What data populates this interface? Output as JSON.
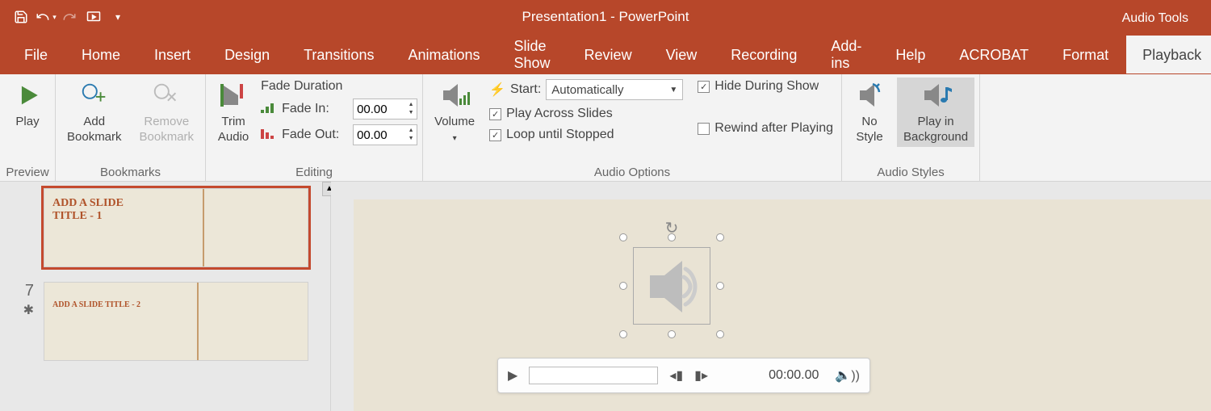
{
  "title": "Presentation1  -  PowerPoint",
  "contextual_title": "Audio Tools",
  "tabs": [
    "File",
    "Home",
    "Insert",
    "Design",
    "Transitions",
    "Animations",
    "Slide Show",
    "Review",
    "View",
    "Recording",
    "Add-ins",
    "Help",
    "ACROBAT"
  ],
  "ctx_tabs": {
    "format": "Format",
    "playback": "Playback"
  },
  "ribbon": {
    "preview": {
      "play": "Play",
      "group": "Preview"
    },
    "bookmarks": {
      "add": "Add\nBookmark",
      "remove": "Remove\nBookmark",
      "group": "Bookmarks"
    },
    "editing": {
      "trim": "Trim\nAudio",
      "fade_header": "Fade Duration",
      "fade_in_label": "Fade In:",
      "fade_out_label": "Fade Out:",
      "fade_in_val": "00.00",
      "fade_out_val": "00.00",
      "group": "Editing"
    },
    "options": {
      "volume": "Volume",
      "start_label": "Start:",
      "start_value": "Automatically",
      "play_across": "Play Across Slides",
      "loop": "Loop until Stopped",
      "hide": "Hide During Show",
      "rewind": "Rewind after Playing",
      "group": "Audio Options"
    },
    "styles": {
      "nostyle": "No\nStyle",
      "bg": "Play in\nBackground",
      "group": "Audio Styles"
    }
  },
  "slides": {
    "s1_title": "ADD A SLIDE\nTITLE - 1",
    "s2_num": "7",
    "s2_title": "ADD A SLIDE TITLE - 2"
  },
  "player": {
    "time": "00:00.00"
  }
}
